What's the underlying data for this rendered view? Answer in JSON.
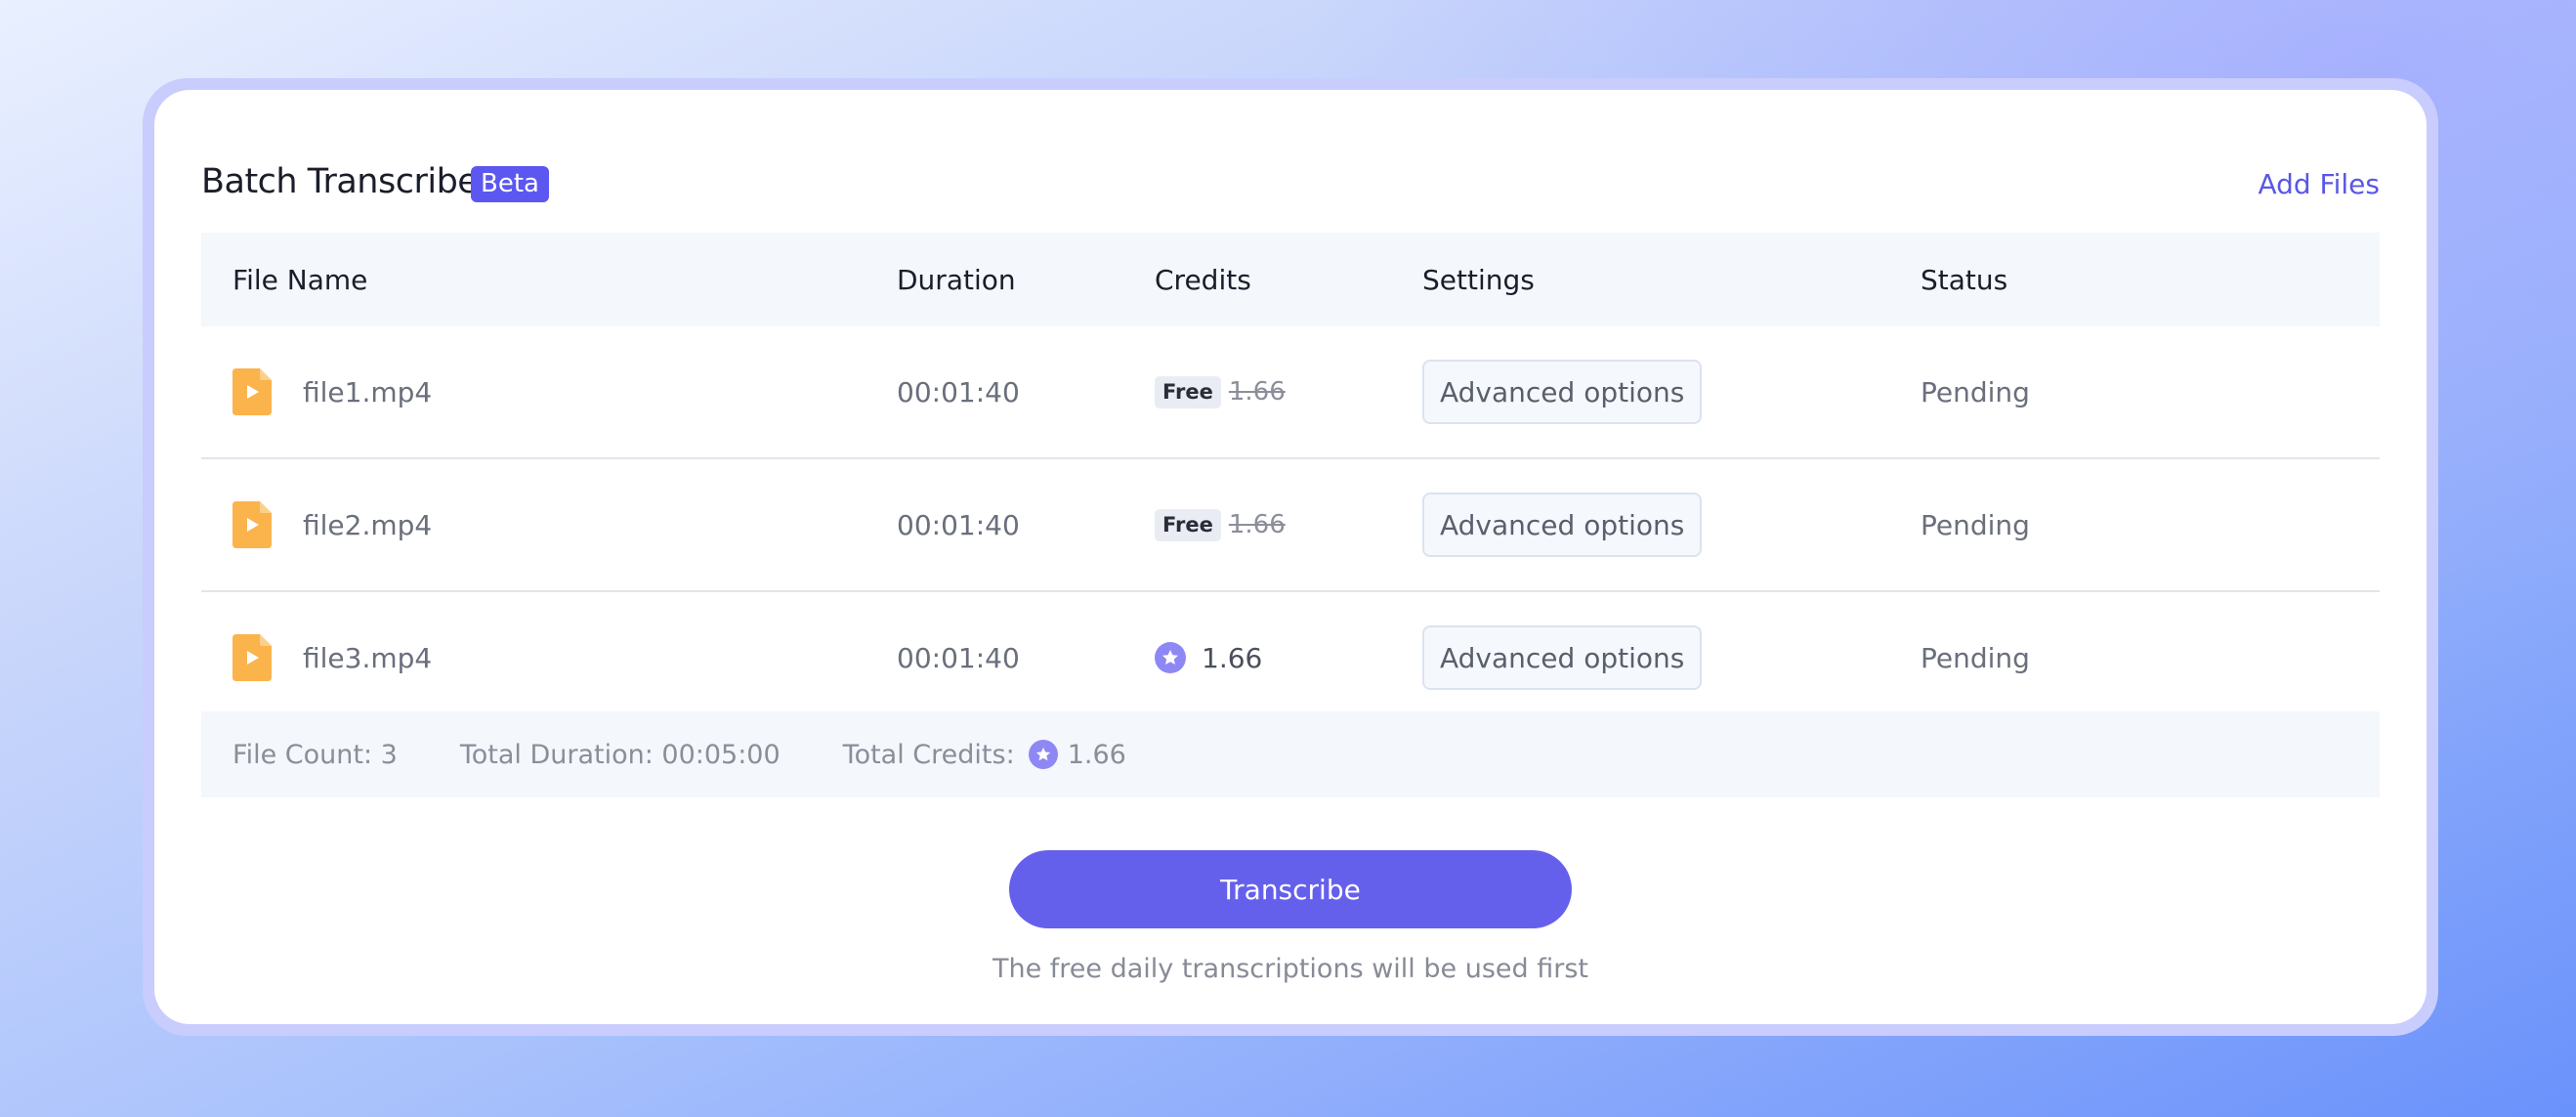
{
  "header": {
    "title": "Batch Transcribe",
    "badge": "Beta",
    "add_files_label": "Add Files"
  },
  "table": {
    "columns": [
      "File Name",
      "Duration",
      "Credits",
      "Settings",
      "Status"
    ],
    "rows": [
      {
        "file_name": "file1.mp4",
        "duration": "00:01:40",
        "credit_tag": "Free",
        "credits": "1.66",
        "credit_type": "free",
        "settings_label": "Advanced options",
        "status": "Pending"
      },
      {
        "file_name": "file2.mp4",
        "duration": "00:01:40",
        "credit_tag": "Free",
        "credits": "1.66",
        "credit_type": "free",
        "settings_label": "Advanced options",
        "status": "Pending"
      },
      {
        "file_name": "file3.mp4",
        "duration": "00:01:40",
        "credit_tag": "",
        "credits": "1.66",
        "credit_type": "paid",
        "settings_label": "Advanced options",
        "status": "Pending"
      }
    ]
  },
  "summary": {
    "file_count": "File Count: 3",
    "total_duration": "Total Duration: 00:05:00",
    "total_credits_label": "Total Credits:",
    "total_credits_value": "1.66"
  },
  "footer": {
    "transcribe_label": "Transcribe",
    "note": "The free daily transcriptions will be used first"
  },
  "colors": {
    "accent": "#6560ec",
    "badge": "#5b57f0",
    "file_icon": "#fbb34b",
    "credit_coin": "#8e88f5"
  },
  "icons": {
    "file": "video-file-icon",
    "credit": "credit-coin-icon"
  }
}
